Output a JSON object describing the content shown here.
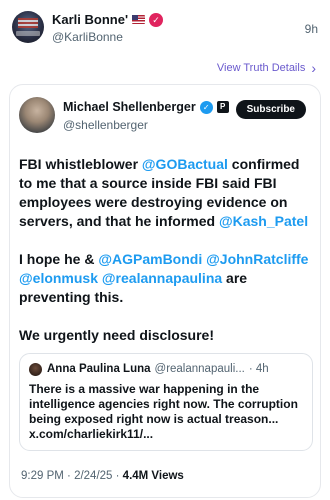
{
  "header": {
    "display_name": "Karli Bonne'",
    "handle": "@KarliBonne",
    "time_ago": "9h",
    "flag_icon": "us-flag-icon",
    "badge_icon": "verified-badge-icon"
  },
  "truth": {
    "view_details_label": "View Truth Details"
  },
  "post": {
    "author": "Michael Shellenberger",
    "handle": "@shellenberger",
    "subscribe_label": "Subscribe",
    "p_badge": "P",
    "para1": {
      "t1": "FBI whistleblower ",
      "m1": "@GOBactual",
      "t2": " confirmed to me that a source inside FBI said FBI employees were destroying evidence on servers, and that he informed ",
      "m2": "@Kash_Patel"
    },
    "para2": {
      "t1": "I hope he & ",
      "m1": "@AGPamBondi",
      "sp1": " ",
      "m2": "@JohnRatcliffe",
      "sp2": " ",
      "m3": "@elonmusk",
      "sp3": " ",
      "m4": "@realannapaulina",
      "t2": " are preventing this."
    },
    "para3": "We urgently need disclosure!",
    "quote": {
      "name": "Anna Paulina Luna",
      "handle": "@realannapauli...",
      "time": "· 4h",
      "text": "There is a massive war happening in the intelligence agencies right now. The corruption being exposed right now is actual treason... x.com/charliekirk11/..."
    },
    "meta": {
      "time": "9:29 PM",
      "sep1": " · ",
      "date": "2/24/25",
      "sep2": " · ",
      "views": "4.4M Views"
    }
  },
  "colors": {
    "link": "#1d9bf0",
    "truth_purple": "#6a5acd",
    "pink_badge": "#e0245e"
  }
}
